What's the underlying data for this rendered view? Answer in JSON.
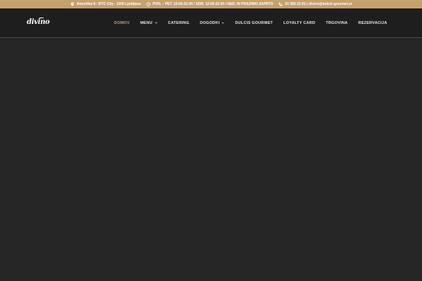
{
  "topbar": {
    "address": "Ameriška 8 - BTC City - 1000 Ljubljana",
    "hours": "PON. – PET. 10:00-22:00 / SOB. 12:00-22:00 / NED. IN PRAZNIKI ZAPRTO",
    "contact": "01 585 22 81 | divino@dulcis-gourmet.si",
    "icons": [
      "map-pin-icon",
      "clock-icon",
      "phone-icon"
    ],
    "background_color": "#c6a06d"
  },
  "logo": {
    "text": "divino"
  },
  "nav": {
    "items": [
      {
        "label": "DOMOV",
        "active": true
      },
      {
        "label": "MENU",
        "dropdown": true
      },
      {
        "label": "CATERING"
      },
      {
        "label": "DOGODKI",
        "dropdown": true
      },
      {
        "label": "DULCIS GOURMET"
      },
      {
        "label": "LOYALTY CARD"
      },
      {
        "label": "TRGOVINA"
      },
      {
        "label": "REZERVACIJA"
      }
    ],
    "active_color": "#c6a06d"
  },
  "colors": {
    "header_background": "#1e1e1e",
    "page_background": "#262626"
  }
}
